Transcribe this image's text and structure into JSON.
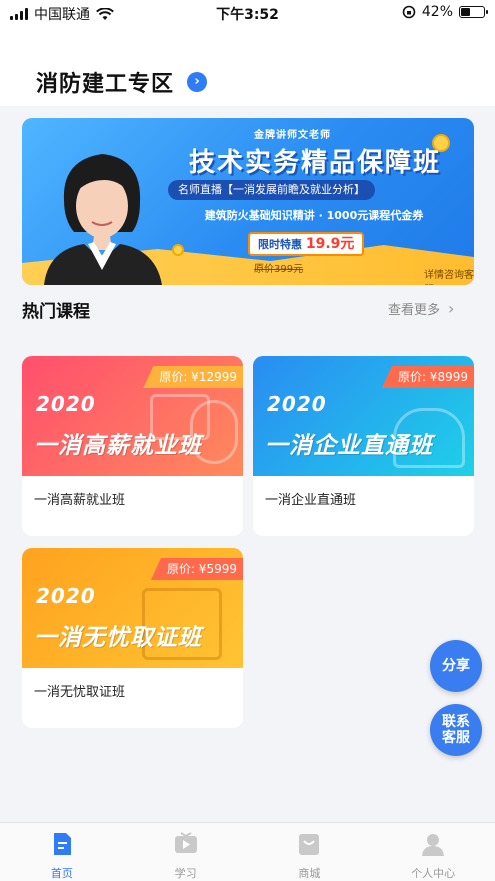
{
  "status_bar": {
    "carrier": "中国联通",
    "time": "下午3:52",
    "battery": "42%",
    "battery_level": 0.42
  },
  "header": {
    "title": "消防建工专区",
    "arrow_icon": "chevron-right-circle-icon"
  },
  "banner": {
    "tag": "金牌讲师文老师",
    "title": "技术实务精品保障班",
    "live": "名师直播【一消发展前瞻及就业分析】",
    "subtitle": "建筑防火基础知识精讲 · 1000元课程代金券",
    "promo_label": "限时特惠",
    "promo_price": "19.9元",
    "original_price": "原价399元",
    "consult": "详情咨询客服"
  },
  "section": {
    "title": "热门课程",
    "more": "查看更多",
    "more_icon": "chevron-right-icon"
  },
  "courses": [
    {
      "year": "2020",
      "headline": "一消高薪就业班",
      "price": "原价: ¥12999",
      "name": "一消高薪就业班",
      "color_from": "#ff4f6d",
      "color_to": "#ff8a5c",
      "tag_color": "#ffb23b"
    },
    {
      "year": "2020",
      "headline": "一消企业直通班",
      "price": "原价: ¥8999",
      "name": "一消企业直通班",
      "color_from": "#2a8cf2",
      "color_to": "#1fd0e8",
      "tag_color": "#ff6a4d"
    },
    {
      "year": "2020",
      "headline": "一消无忧取证班",
      "price": "原价: ¥5999",
      "name": "一消无忧取证班",
      "color_from": "#ffa21f",
      "color_to": "#ffc433",
      "tag_color": "#ff6a4d"
    }
  ],
  "fabs": {
    "share": "分享",
    "service": "联系客服"
  },
  "tabs": [
    {
      "label": "首页",
      "icon": "home-document-icon",
      "active": true
    },
    {
      "label": "学习",
      "icon": "video-play-icon",
      "active": false
    },
    {
      "label": "商城",
      "icon": "shopping-bag-icon",
      "active": false
    },
    {
      "label": "个人中心",
      "icon": "user-profile-icon",
      "active": false
    }
  ]
}
